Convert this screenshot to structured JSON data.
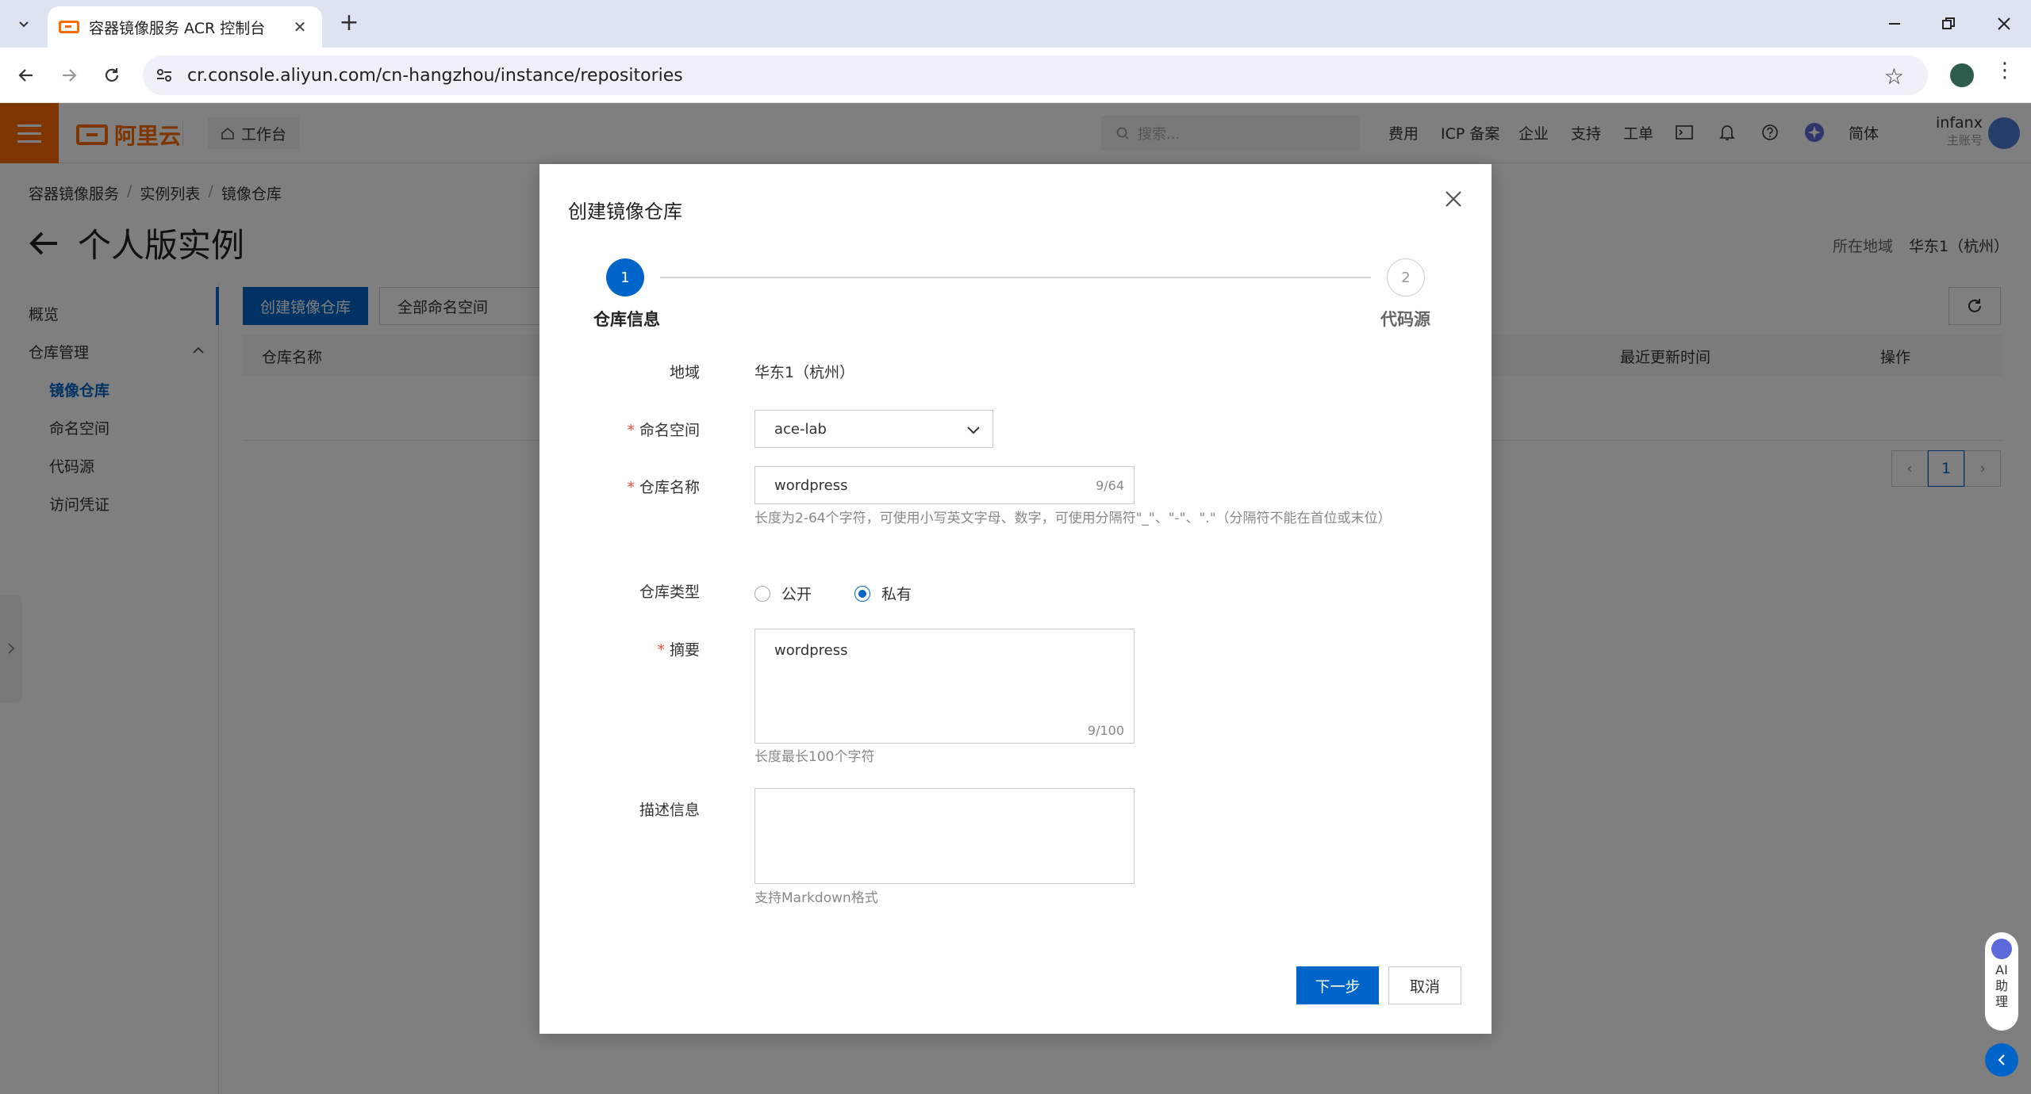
{
  "browser": {
    "tab_title": "容器镜像服务 ACR 控制台",
    "url": "cr.console.aliyun.com/cn-hangzhou/instance/repositories"
  },
  "topnav": {
    "logo_text": "阿里云",
    "workbench": "工作台",
    "search_placeholder": "搜索...",
    "links": [
      "费用",
      "ICP 备案",
      "企业",
      "支持",
      "工单"
    ],
    "lang": "简体",
    "user_name": "infanx",
    "user_role": "主账号"
  },
  "page": {
    "breadcrumb": [
      "容器镜像服务",
      "实例列表",
      "镜像仓库"
    ],
    "title": "个人版实例",
    "region_label": "所在地域",
    "region_value": "华东1（杭州）"
  },
  "sidebar": {
    "overview": "概览",
    "repo_mgmt": "仓库管理",
    "items": [
      "镜像仓库",
      "命名空间",
      "代码源",
      "访问凭证"
    ]
  },
  "toolbar": {
    "create_repo": "创建镜像仓库",
    "namespace_filter": "全部命名空间"
  },
  "table": {
    "columns": [
      "仓库名称",
      "最近更新时间",
      "操作"
    ],
    "page_current": "1"
  },
  "ai_assistant": {
    "label_lines": [
      "AI",
      "助",
      "理"
    ]
  },
  "modal": {
    "title": "创建镜像仓库",
    "steps": [
      {
        "number": "1",
        "label": "仓库信息",
        "active": true
      },
      {
        "number": "2",
        "label": "代码源",
        "active": false
      }
    ],
    "form": {
      "region_label": "地域",
      "region_value": "华东1（杭州）",
      "namespace_label": "命名空间",
      "namespace_value": "ace-lab",
      "repo_name_label": "仓库名称",
      "repo_name_value": "wordpress",
      "repo_name_counter": "9/64",
      "repo_name_hint": "长度为2-64个字符，可使用小写英文字母、数字，可使用分隔符\"_\"、\"-\"、\".\"（分隔符不能在首位或末位）",
      "repo_type_label": "仓库类型",
      "repo_type_options": [
        "公开",
        "私有"
      ],
      "repo_type_selected": "私有",
      "summary_label": "摘要",
      "summary_value": "wordpress",
      "summary_counter": "9/100",
      "summary_hint": "长度最长100个字符",
      "description_label": "描述信息",
      "description_value": "",
      "description_hint": "支持Markdown格式"
    },
    "buttons": {
      "next": "下一步",
      "cancel": "取消"
    }
  }
}
